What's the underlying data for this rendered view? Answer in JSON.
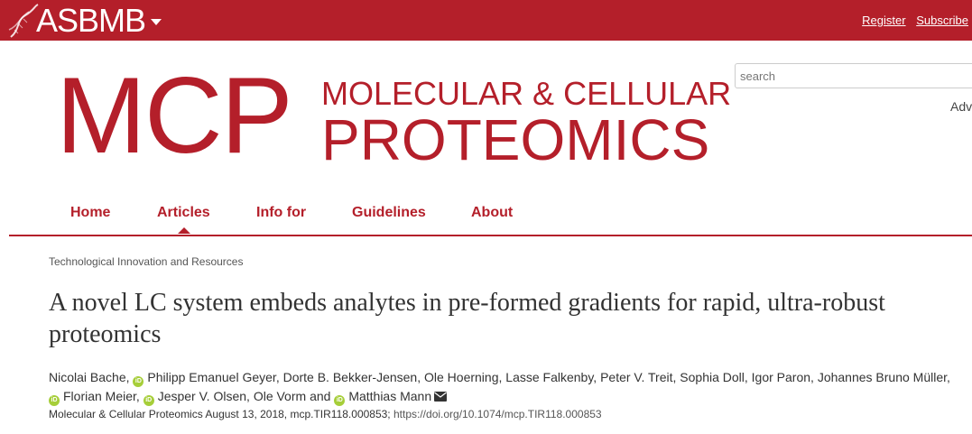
{
  "topbar": {
    "brand": "ASBMB",
    "register": "Register",
    "subscribe": "Subscribe"
  },
  "header": {
    "logo_short": "MCP",
    "logo_line1": "MOLECULAR & CELLULAR",
    "logo_line2": "PROTEOMICS",
    "search_placeholder": "search",
    "advanced": "Adv"
  },
  "nav": {
    "items": [
      "Home",
      "Articles",
      "Info for",
      "Guidelines",
      "About"
    ],
    "active": "Articles"
  },
  "article": {
    "section": "Technological Innovation and Resources",
    "title": "A novel LC system embeds analytes in pre-formed gradients for rapid, ultra-robust proteomics",
    "authors": [
      {
        "name": "Nicolai Bache",
        "orcid": false
      },
      {
        "name": "Philipp Emanuel Geyer",
        "orcid": true
      },
      {
        "name": "Dorte B. Bekker-Jensen",
        "orcid": false
      },
      {
        "name": "Ole Hoerning",
        "orcid": false
      },
      {
        "name": "Lasse Falkenby",
        "orcid": false
      },
      {
        "name": "Peter V. Treit",
        "orcid": false
      },
      {
        "name": "Sophia Doll",
        "orcid": false
      },
      {
        "name": "Igor Paron",
        "orcid": false
      },
      {
        "name": "Johannes Bruno Müller",
        "orcid": false
      },
      {
        "name": "Florian Meier",
        "orcid": true
      },
      {
        "name": "Jesper V. Olsen",
        "orcid": true
      },
      {
        "name": "Ole Vorm",
        "orcid": false
      },
      {
        "name": "Matthias Mann",
        "orcid": true
      }
    ],
    "author_and": "and",
    "citation_text": "Molecular & Cellular Proteomics August 13, 2018, mcp.TIR118.000853;",
    "doi": "https://doi.org/10.1074/mcp.TIR118.000853"
  },
  "colors": {
    "brand_red": "#b41f2a",
    "orcid_green": "#a6ce39"
  },
  "icons": [
    "asbmb-helix-icon",
    "dropdown-caret-icon",
    "orcid-icon",
    "envelope-icon"
  ]
}
